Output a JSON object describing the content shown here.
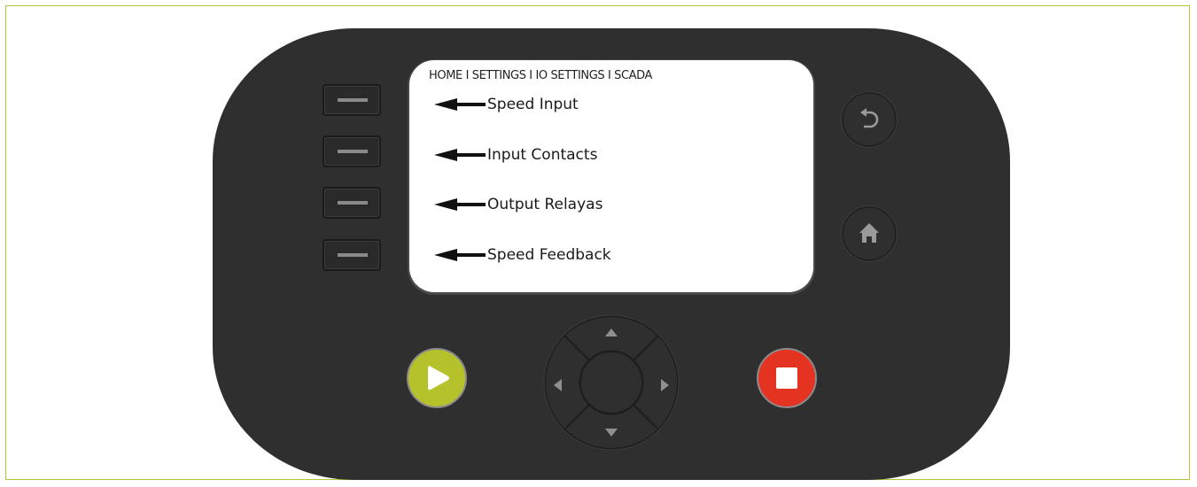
{
  "screen": {
    "breadcrumb": "HOME I SETTINGS I IO SETTINGS I SCADA",
    "menu_items": [
      {
        "label": "Speed Input"
      },
      {
        "label": "Input Contacts"
      },
      {
        "label": "Output Relayas"
      },
      {
        "label": "Speed Feedback"
      }
    ]
  },
  "colors": {
    "device_body": "#2f2f2f",
    "screen": "#ffffff",
    "frame_border": "#b3c33a",
    "play_button": "#b6c22c",
    "stop_button": "#e53321"
  },
  "icons": {
    "back": "back-arrow-icon",
    "home": "home-icon",
    "play": "play-icon",
    "stop": "stop-icon",
    "up": "triangle-up-icon",
    "down": "triangle-down-icon",
    "left": "triangle-left-icon",
    "right": "triangle-right-icon"
  }
}
